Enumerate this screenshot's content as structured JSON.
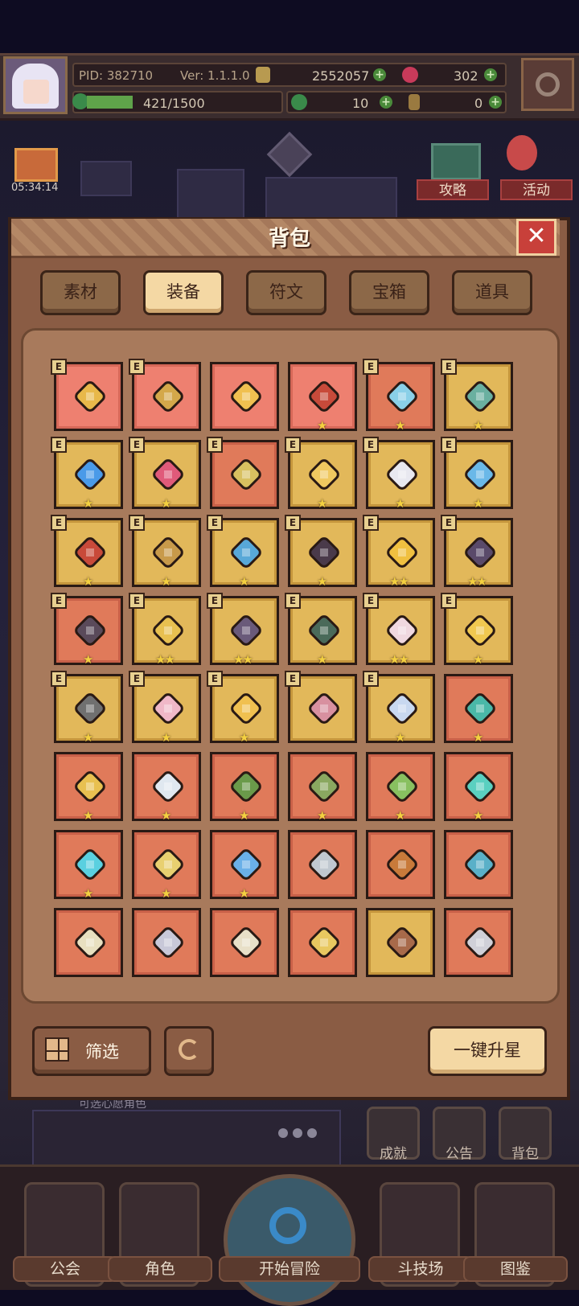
{
  "topbar": {
    "pid": "PID: 382710",
    "version": "Ver: 1.1.1.0",
    "gold": "2552057",
    "gems": "302",
    "stamina": "421/1500",
    "stamina_fill": 0.28,
    "clover": "10",
    "keys": "0"
  },
  "scene": {
    "timer": "05:34:14",
    "guide_label": "攻略",
    "event_label": "活动",
    "bg_text": "可选心愿角色"
  },
  "modal": {
    "title": "背包",
    "close": "✕",
    "tabs": [
      "素材",
      "装备",
      "符文",
      "宝箱",
      "道具"
    ],
    "active_tab": "装备",
    "filter_label": "筛选",
    "star_up_label": "一键升星",
    "equipped_badge": "E"
  },
  "items": [
    {
      "icon": "straw-hat-icon",
      "bg": "pink",
      "equipped": true,
      "stars": ""
    },
    {
      "icon": "gold-ring-icon",
      "bg": "pink",
      "equipped": true,
      "stars": ""
    },
    {
      "icon": "horned-helmet-icon",
      "bg": "pink",
      "equipped": false,
      "stars": ""
    },
    {
      "icon": "crown-helmet-icon",
      "bg": "pink",
      "equipped": false,
      "stars": "★"
    },
    {
      "icon": "ice-dagger-icon",
      "bg": "red",
      "equipped": true,
      "stars": "★"
    },
    {
      "icon": "jade-staff-icon",
      "bg": "gold",
      "equipped": true,
      "stars": "★"
    },
    {
      "icon": "orb-wand-icon",
      "bg": "gold",
      "equipped": true,
      "stars": "★"
    },
    {
      "icon": "teddy-bear-icon",
      "bg": "gold",
      "equipped": true,
      "stars": "★"
    },
    {
      "icon": "gem-shield-icon",
      "bg": "red",
      "equipped": true,
      "stars": ""
    },
    {
      "icon": "gold-bracelet-icon",
      "bg": "gold",
      "equipped": true,
      "stars": "★"
    },
    {
      "icon": "winged-helmet-icon",
      "bg": "gold",
      "equipped": true,
      "stars": "★"
    },
    {
      "icon": "crystal-armor-icon",
      "bg": "gold",
      "equipped": true,
      "stars": "★"
    },
    {
      "icon": "royal-cape-icon",
      "bg": "gold",
      "equipped": true,
      "stars": "★"
    },
    {
      "icon": "bone-club-icon",
      "bg": "gold",
      "equipped": true,
      "stars": "★"
    },
    {
      "icon": "ice-glove-icon",
      "bg": "gold",
      "equipped": true,
      "stars": "★"
    },
    {
      "icon": "demon-mask-icon",
      "bg": "gold",
      "equipped": true,
      "stars": "★"
    },
    {
      "icon": "ruby-ring-icon",
      "bg": "gold",
      "equipped": true,
      "stars": "★★"
    },
    {
      "icon": "dark-armor-icon",
      "bg": "gold",
      "equipped": true,
      "stars": "★★"
    },
    {
      "icon": "dark-belt-icon",
      "bg": "red",
      "equipped": true,
      "stars": "★"
    },
    {
      "icon": "gold-boots-icon",
      "bg": "gold",
      "equipped": true,
      "stars": "★★"
    },
    {
      "icon": "iron-boots-icon",
      "bg": "gold",
      "equipped": true,
      "stars": "★★"
    },
    {
      "icon": "red-boots-icon",
      "bg": "gold",
      "equipped": true,
      "stars": "★"
    },
    {
      "icon": "winged-heart-icon",
      "bg": "gold",
      "equipped": true,
      "stars": "★★"
    },
    {
      "icon": "sun-medal-icon",
      "bg": "gold",
      "equipped": true,
      "stars": "★"
    },
    {
      "icon": "iron-orb-icon",
      "bg": "gold",
      "equipped": true,
      "stars": "★"
    },
    {
      "icon": "heart-necklace-icon",
      "bg": "gold",
      "equipped": true,
      "stars": "★"
    },
    {
      "icon": "gold-necklace-icon",
      "bg": "gold",
      "equipped": true,
      "stars": "★"
    },
    {
      "icon": "heart-amulet-icon",
      "bg": "gold",
      "equipped": true,
      "stars": ""
    },
    {
      "icon": "crystal-ring-icon",
      "bg": "gold",
      "equipped": true,
      "stars": "★"
    },
    {
      "icon": "jade-bow-icon",
      "bg": "red",
      "equipped": false,
      "stars": "★"
    },
    {
      "icon": "sapphire-staff-icon",
      "bg": "red",
      "equipped": false,
      "stars": "★"
    },
    {
      "icon": "silver-scepter-icon",
      "bg": "red",
      "equipped": false,
      "stars": "★"
    },
    {
      "icon": "leaf-sword-icon",
      "bg": "red",
      "equipped": false,
      "stars": "★"
    },
    {
      "icon": "vine-bow-icon",
      "bg": "red",
      "equipped": false,
      "stars": "★"
    },
    {
      "icon": "leaf-blade-icon",
      "bg": "red",
      "equipped": false,
      "stars": "★"
    },
    {
      "icon": "cyan-club-icon",
      "bg": "red",
      "equipped": false,
      "stars": "★"
    },
    {
      "icon": "frost-axe-icon",
      "bg": "red",
      "equipped": false,
      "stars": "★"
    },
    {
      "icon": "gold-sword-icon",
      "bg": "red",
      "equipped": false,
      "stars": "★"
    },
    {
      "icon": "blue-sword-icon",
      "bg": "red",
      "equipped": false,
      "stars": "★"
    },
    {
      "icon": "crossed-swords-icon",
      "bg": "red",
      "equipped": false,
      "stars": ""
    },
    {
      "icon": "crossbow-icon",
      "bg": "red",
      "equipped": false,
      "stars": ""
    },
    {
      "icon": "ice-spear-icon",
      "bg": "red",
      "equipped": false,
      "stars": ""
    },
    {
      "icon": "silver-bow-icon",
      "bg": "red",
      "equipped": false,
      "stars": ""
    },
    {
      "icon": "steel-sword-icon",
      "bg": "red",
      "equipped": false,
      "stars": ""
    },
    {
      "icon": "battle-axe-icon",
      "bg": "red",
      "equipped": false,
      "stars": ""
    },
    {
      "icon": "gold-mace-icon",
      "bg": "red",
      "equipped": false,
      "stars": ""
    },
    {
      "icon": "wood-staff-icon",
      "bg": "gold",
      "equipped": false,
      "stars": ""
    },
    {
      "icon": "short-dagger-icon",
      "bg": "red",
      "equipped": false,
      "stars": ""
    }
  ],
  "side_buttons": [
    {
      "label": "成就",
      "icon": "trophy-icon"
    },
    {
      "label": "公告",
      "icon": "megaphone-icon"
    },
    {
      "label": "背包",
      "icon": "bag-icon"
    }
  ],
  "nav": [
    {
      "label": "公会",
      "icon": "guild-icon"
    },
    {
      "label": "角色",
      "icon": "character-icon"
    },
    {
      "label": "开始冒险",
      "icon": "magnifier-icon"
    },
    {
      "label": "斗技场",
      "icon": "arena-swords-icon"
    },
    {
      "label": "图鉴",
      "icon": "codex-icon"
    }
  ],
  "colors": {
    "slot_red": "#e07a5a",
    "slot_gold": "#e2b85a",
    "slot_pink": "#ee8070",
    "modal_bg": "#8a5c44",
    "tab_active": "#f4d8a4",
    "star": "#f4d040"
  }
}
